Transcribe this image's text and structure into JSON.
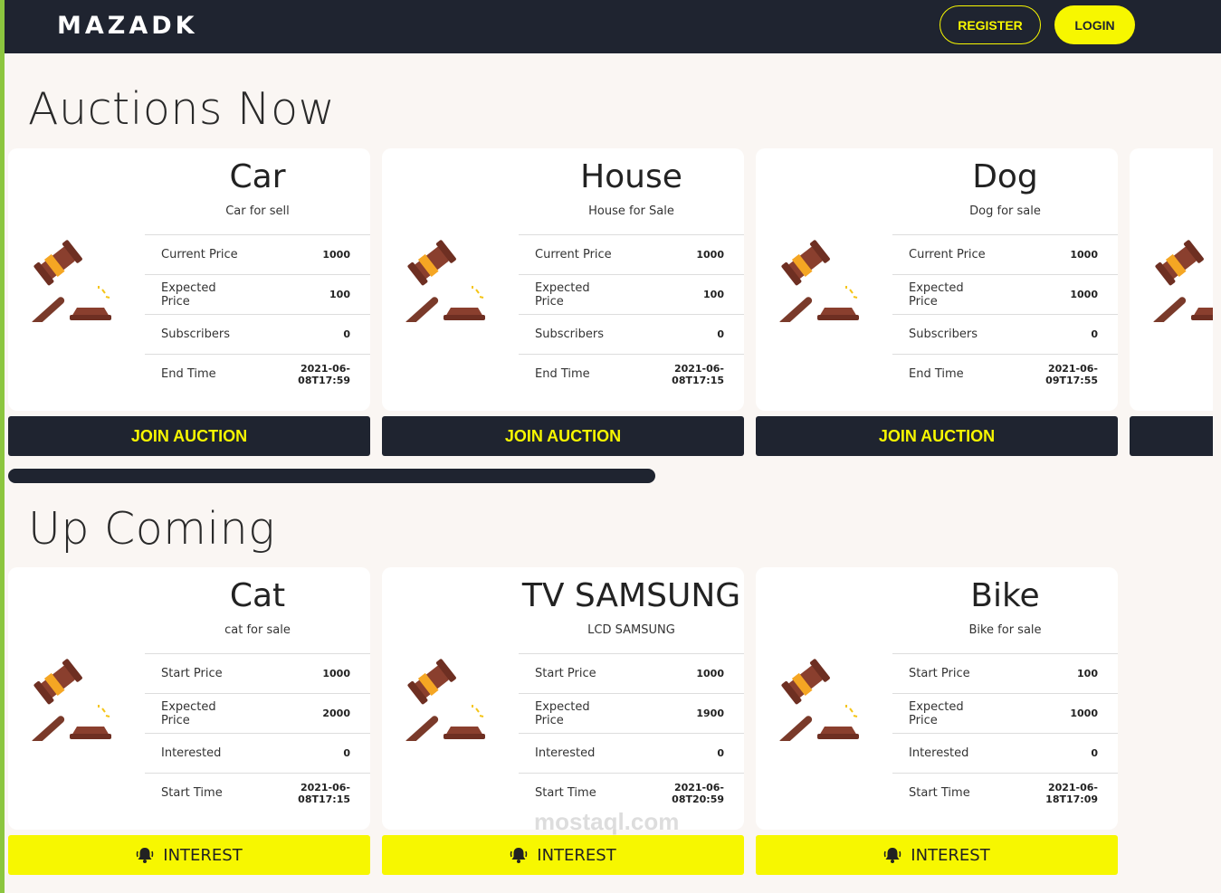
{
  "header": {
    "brand": "MAZADK",
    "register_label": "REGISTER",
    "login_label": "LOGIN"
  },
  "auctions_now": {
    "title": "Auctions Now",
    "button_label": "JOIN AUCTION",
    "cards": [
      {
        "title": "Car",
        "subtitle": "Car for sell",
        "rows": [
          {
            "label": "Current Price",
            "value": "1000"
          },
          {
            "label": "Expected Price",
            "value": "100"
          },
          {
            "label": "Subscribers",
            "value": "0"
          },
          {
            "label": "End Time",
            "value": "2021-06-08T17:59"
          }
        ]
      },
      {
        "title": "House",
        "subtitle": "House for Sale",
        "rows": [
          {
            "label": "Current Price",
            "value": "1000"
          },
          {
            "label": "Expected Price",
            "value": "100"
          },
          {
            "label": "Subscribers",
            "value": "0"
          },
          {
            "label": "End Time",
            "value": "2021-06-08T17:15"
          }
        ]
      },
      {
        "title": "Dog",
        "subtitle": "Dog for sale",
        "rows": [
          {
            "label": "Current Price",
            "value": "1000"
          },
          {
            "label": "Expected Price",
            "value": "1000"
          },
          {
            "label": "Subscribers",
            "value": "0"
          },
          {
            "label": "End Time",
            "value": "2021-06-09T17:55"
          }
        ]
      }
    ]
  },
  "upcoming": {
    "title": "Up Coming",
    "button_label": "INTEREST",
    "cards": [
      {
        "title": "Cat",
        "subtitle": "cat for sale",
        "rows": [
          {
            "label": "Start Price",
            "value": "1000"
          },
          {
            "label": "Expected Price",
            "value": "2000"
          },
          {
            "label": "Interested",
            "value": "0"
          },
          {
            "label": "Start Time",
            "value": "2021-06-08T17:15"
          }
        ]
      },
      {
        "title": "TV SAMSUNG",
        "subtitle": "LCD SAMSUNG",
        "rows": [
          {
            "label": "Start Price",
            "value": "1000"
          },
          {
            "label": "Expected Price",
            "value": "1900"
          },
          {
            "label": "Interested",
            "value": "0"
          },
          {
            "label": "Start Time",
            "value": "2021-06-08T20:59"
          }
        ]
      },
      {
        "title": "Bike",
        "subtitle": "Bike for sale",
        "rows": [
          {
            "label": "Start Price",
            "value": "100"
          },
          {
            "label": "Expected Price",
            "value": "1000"
          },
          {
            "label": "Interested",
            "value": "0"
          },
          {
            "label": "Start Time",
            "value": "2021-06-18T17:09"
          }
        ]
      }
    ]
  },
  "watermark": "mostaql.com"
}
